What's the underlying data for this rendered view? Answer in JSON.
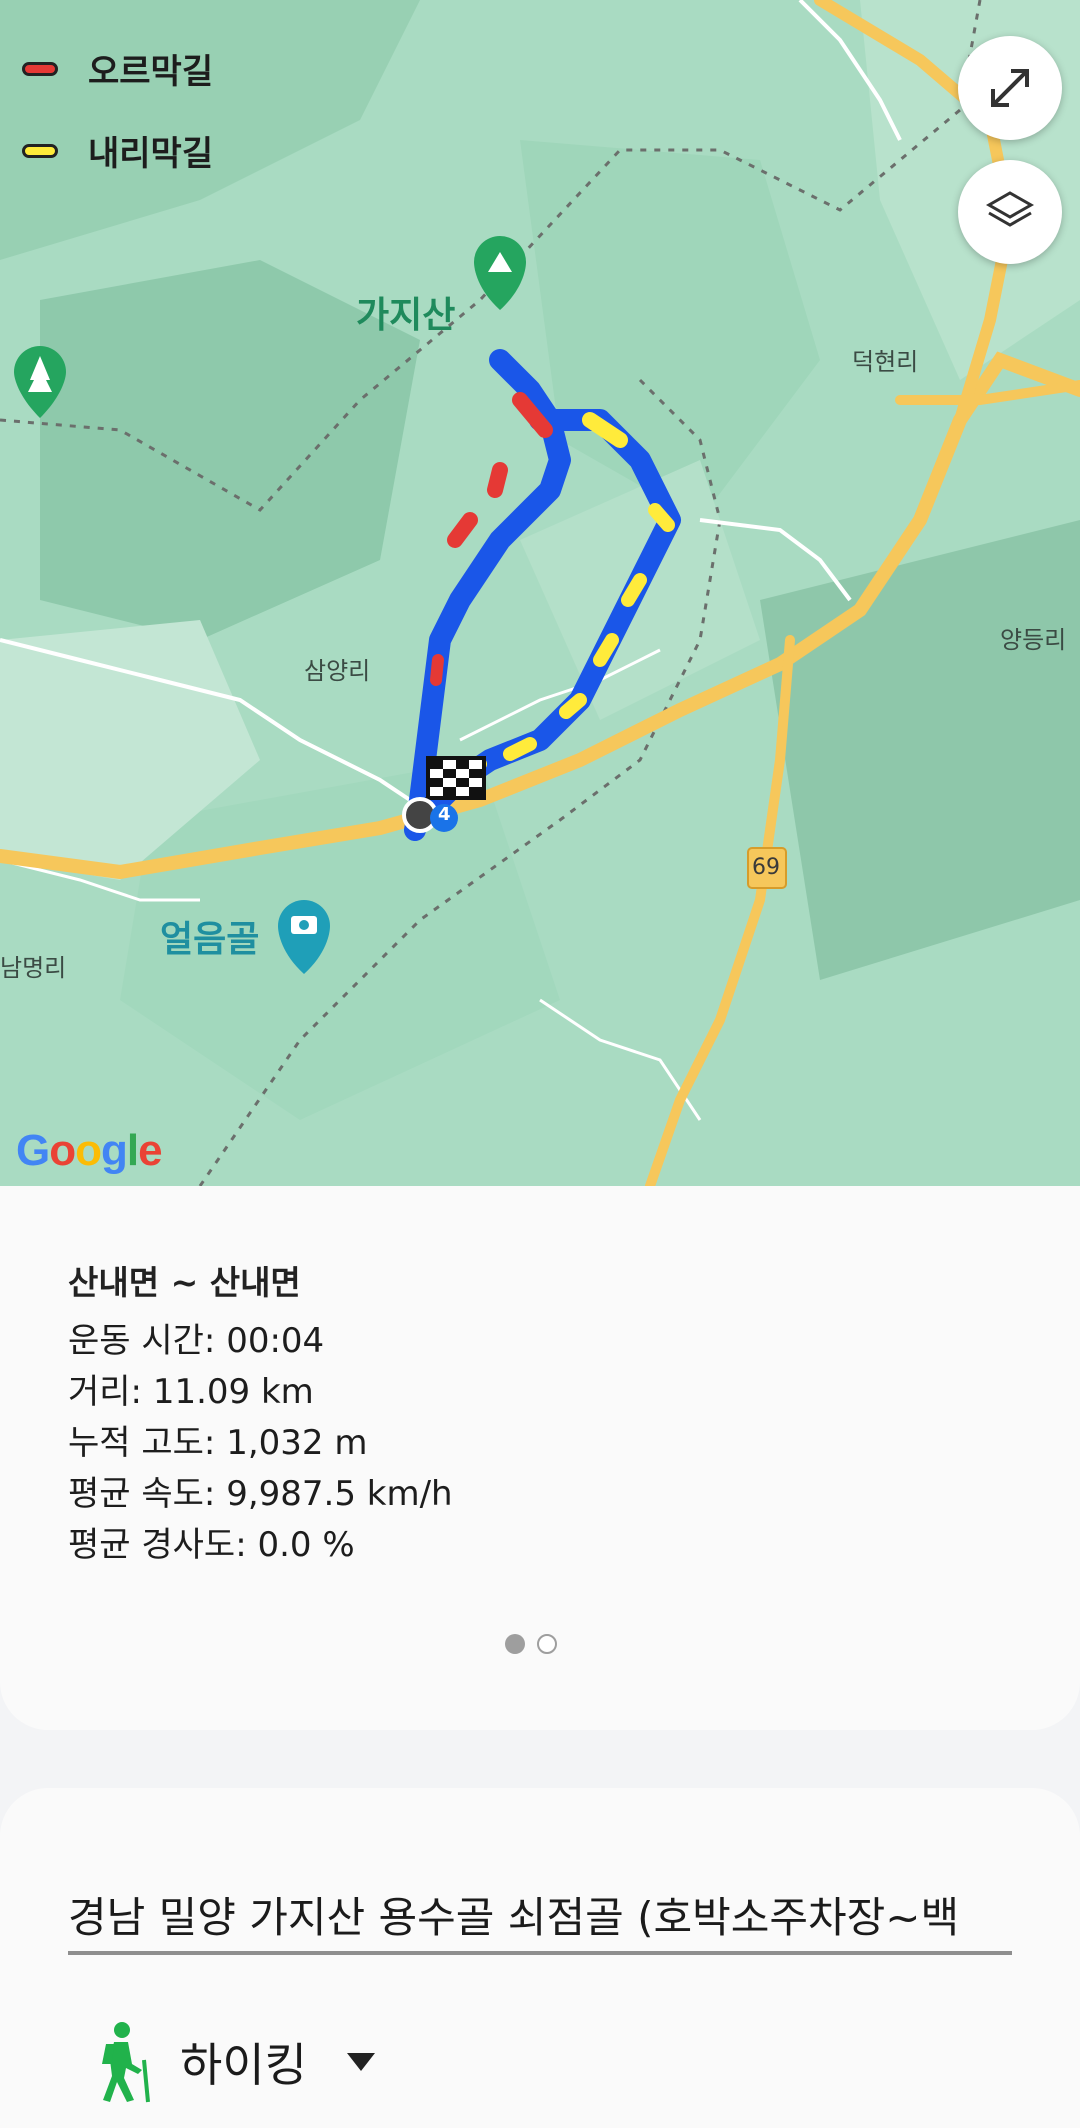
{
  "map": {
    "legend": [
      {
        "label": "오르막길",
        "color": "#e53935"
      },
      {
        "label": "내리막길",
        "color": "#ffeb3b"
      }
    ],
    "buttons": {
      "expand_icon": "expand-arrows-icon",
      "layers_icon": "layers-icon"
    },
    "places": {
      "mountain": "가지산",
      "deokhyeon": "덕현리",
      "samyang": "삼양리",
      "yangdeung": "양등리",
      "eoleumgol": "얼음골",
      "nammyeong": "남명리",
      "route_number": "69",
      "route_number_small": "4"
    },
    "attribution": "Google",
    "colors": {
      "route": "#1a56e8",
      "road": "#f6c75b",
      "park": "#25a55f"
    }
  },
  "summary": {
    "title": "산내면 ~ 산내면",
    "stats": [
      "운동 시간: 00:04",
      "거리: 11.09 km",
      "누적 고도: 1,032 m",
      "평균 속도: 9,987.5 km/h",
      "평균 경사도: 0.0 %"
    ],
    "page_index": 1,
    "page_count": 2
  },
  "record": {
    "title": "경남 밀양 가지산 용수골 쇠점골 (호박소주차장~백",
    "activity": "하이킹",
    "activity_icon": "hiking-person-icon"
  }
}
